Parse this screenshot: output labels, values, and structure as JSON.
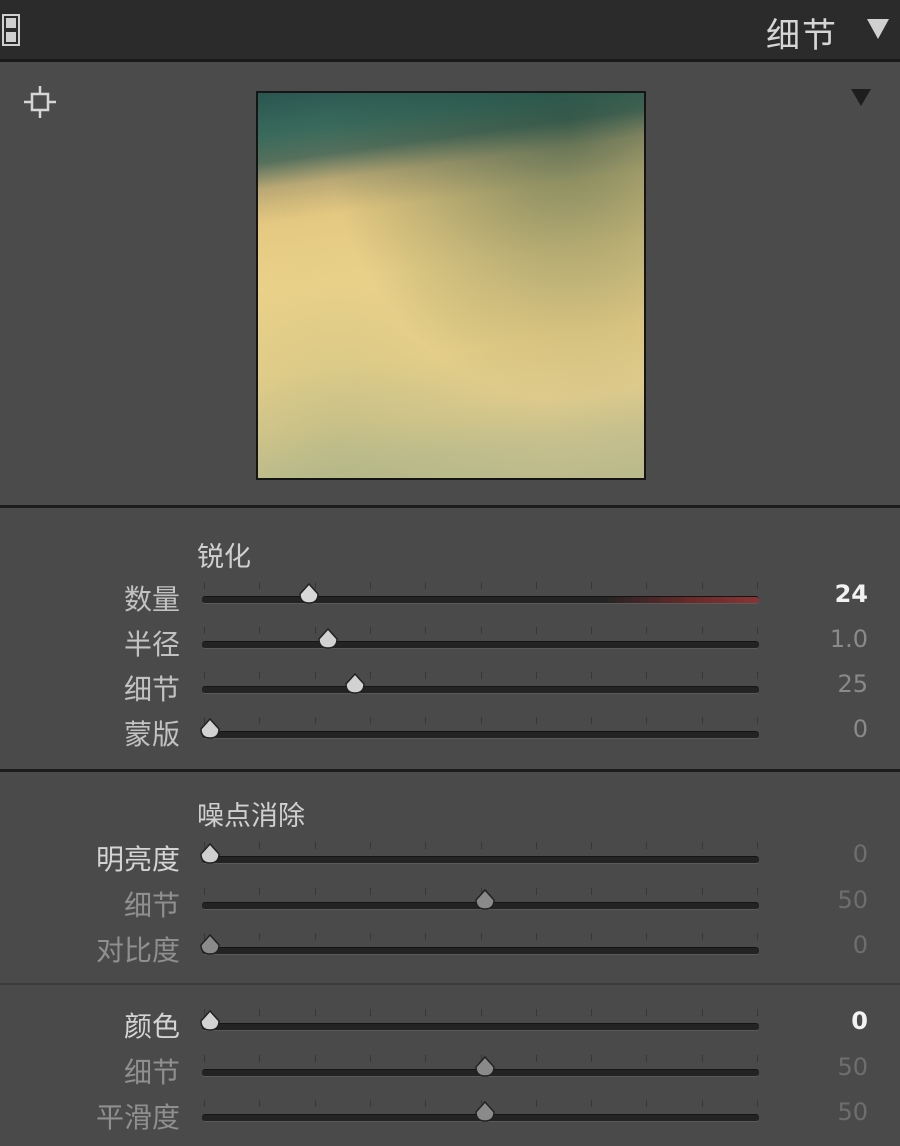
{
  "header": {
    "title": "细节"
  },
  "sharpening": {
    "title": "锐化",
    "sliders": [
      {
        "label": "数量",
        "value": "24",
        "position": 0.18
      },
      {
        "label": "半径",
        "value": "1.0",
        "position": 0.215
      },
      {
        "label": "细节",
        "value": "25",
        "position": 0.265
      },
      {
        "label": "蒙版",
        "value": "0",
        "position": 0.0
      }
    ]
  },
  "noise_reduction": {
    "title": "噪点消除",
    "sliders": [
      {
        "label": "明亮度",
        "value": "0",
        "position": 0.0
      },
      {
        "label": "细节",
        "value": "50",
        "position": 0.5
      },
      {
        "label": "对比度",
        "value": "0",
        "position": 0.0
      }
    ]
  },
  "color_noise": {
    "sliders": [
      {
        "label": "颜色",
        "value": "0",
        "position": 0.0
      },
      {
        "label": "细节",
        "value": "50",
        "position": 0.5
      },
      {
        "label": "平滑度",
        "value": "50",
        "position": 0.5
      }
    ]
  }
}
